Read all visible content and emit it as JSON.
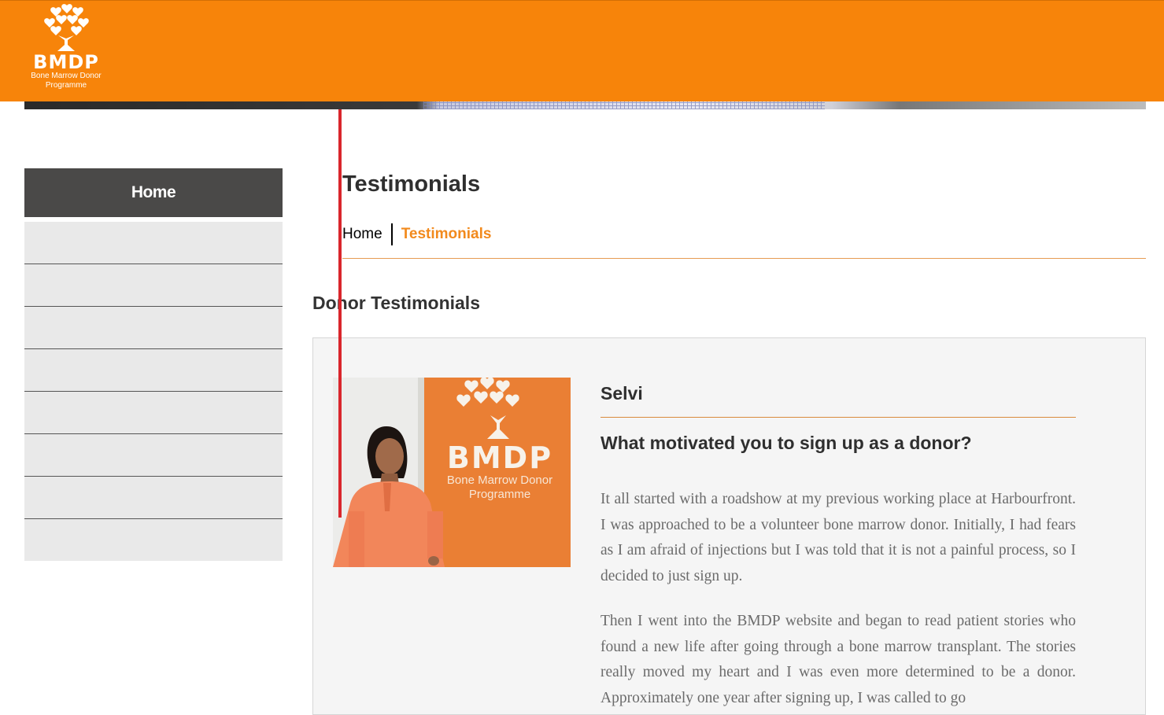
{
  "header": {
    "logo": {
      "brand": "BMDP",
      "subtitle_line1": "Bone Marrow Donor",
      "subtitle_line2": "Programme"
    },
    "color": "#f7840a"
  },
  "sidebar": {
    "home_label": "Home",
    "items": [
      "",
      "",
      "",
      "",
      "",
      "",
      "",
      ""
    ]
  },
  "main": {
    "page_title": "Testimonials",
    "breadcrumb": {
      "home": "Home",
      "current": "Testimonials"
    },
    "section_title": "Donor Testimonials",
    "testimonial": {
      "name": "Selvi",
      "question": "What motivated you to sign up as a donor?",
      "paragraphs": [
        "It all started with a roadshow at my previous working place at Harbourfront. I was approached to be a volunteer bone marrow donor. Initially, I had fears as I am afraid of injections but I was told that it is not a painful process, so I decided to just sign up.",
        "Then I went into the BMDP website and began to read patient stories who found a new life after going through a bone marrow transplant. The stories really moved my heart and I was even more determined to be a donor. Approximately one year after signing up, I was called to go"
      ],
      "photo_sign": {
        "brand": "BMDP",
        "line1": "Bone Marrow Donor",
        "line2": "Programme"
      }
    }
  },
  "colors": {
    "accent": "#f7840a",
    "breadcrumb_current": "#f28a1d",
    "sidebar_active": "#4a4948",
    "indicator_line": "#d9262c"
  }
}
